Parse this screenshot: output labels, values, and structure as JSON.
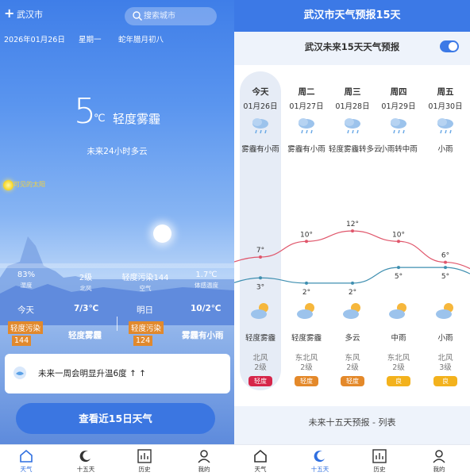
{
  "left": {
    "city": "武汉市",
    "search_placeholder": "搜索城市",
    "date": "2026年01月26日",
    "weekday": "星期一",
    "lunar": "蛇年腊月初八",
    "temp": "5",
    "temp_unit": "℃",
    "condition": "轻度雾霾",
    "forecast_24h": "未来24小时多云",
    "sun_label": "可见的太阳",
    "stats": [
      {
        "value": "83%",
        "label": "湿度"
      },
      {
        "value": "2级",
        "label": "北风"
      },
      {
        "value": "轻度污染144",
        "label": "空气"
      },
      {
        "value": "1.7℃",
        "label": "体感温度"
      }
    ],
    "today": {
      "label": "今天",
      "range": "7/3℃",
      "pollution": "轻度污染",
      "aqi": "144",
      "condition": "轻度雾霾"
    },
    "tomorrow": {
      "label": "明日",
      "range": "10/2℃",
      "pollution": "轻度污染",
      "aqi": "124",
      "condition": "雾霾有小雨"
    },
    "notice": "未来一周会明显升温6度 ↑ ↑",
    "cta": "查看近15日天气"
  },
  "nav": [
    {
      "label": "天气",
      "icon": "home-icon"
    },
    {
      "label": "十五天",
      "icon": "moon-icon"
    },
    {
      "label": "历史",
      "icon": "chart-icon"
    },
    {
      "label": "我的",
      "icon": "user-icon"
    }
  ],
  "right": {
    "header": "武汉市天气预报15天",
    "subtitle": "武汉未来15天天气预报",
    "footer": "未来十五天预报 - 列表",
    "days": [
      {
        "name": "今天",
        "date": "01月26日",
        "cond": "雾霾有小雨",
        "high": "7°",
        "low": "3°",
        "cond2": "轻度雾霾",
        "wind": "北风",
        "wind_level": "2级",
        "aqi": "轻度",
        "aqi_color": "#d6264a"
      },
      {
        "name": "周二",
        "date": "01月27日",
        "cond": "雾霾有小雨",
        "high": "10°",
        "low": "2°",
        "cond2": "轻度雾霾",
        "wind": "东北风",
        "wind_level": "2级",
        "aqi": "轻度",
        "aqi_color": "#e4892a"
      },
      {
        "name": "周三",
        "date": "01月28日",
        "cond": "轻度雾霾转多云",
        "high": "12°",
        "low": "2°",
        "cond2": "多云",
        "wind": "东风",
        "wind_level": "2级",
        "aqi": "轻度",
        "aqi_color": "#e4892a"
      },
      {
        "name": "周四",
        "date": "01月29日",
        "cond": "小雨转中雨",
        "high": "10°",
        "low": "5°",
        "cond2": "中雨",
        "wind": "东北风",
        "wind_level": "2级",
        "aqi": "良",
        "aqi_color": "#f3b21d"
      },
      {
        "name": "周五",
        "date": "01月30日",
        "cond": "小雨",
        "high": "6°",
        "low": "5°",
        "cond2": "小雨",
        "wind": "北风",
        "wind_level": "3级",
        "aqi": "良",
        "aqi_color": "#f3b21d"
      }
    ],
    "colors": {
      "accent": "#3c79e6",
      "high_line": "#e0566b",
      "low_line": "#3f8fb0"
    }
  }
}
